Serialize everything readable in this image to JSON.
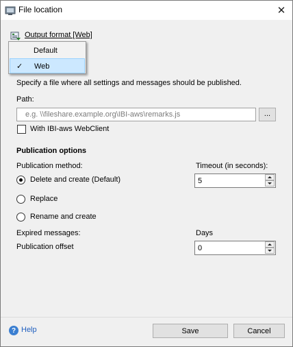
{
  "window": {
    "title": "File location",
    "close_glyph": "✕"
  },
  "output_format": {
    "link_text": "Output format [Web]",
    "icon": "output-format-icon",
    "menu": [
      {
        "label": "Default",
        "selected": false
      },
      {
        "label": "Web",
        "selected": true
      }
    ],
    "check_glyph": "✓"
  },
  "description": "Specify a file where all settings and messages should be published.",
  "path": {
    "label": "Path:",
    "placeholder": "e.g. \\\\fileshare.example.org\\IBI-aws\\remarks.js",
    "value": "",
    "browse_label": "..."
  },
  "webclient": {
    "label": "With IBI-aws WebClient",
    "checked": false
  },
  "publication": {
    "section_title": "Publication options",
    "method_label": "Publication method:",
    "timeout_label": "Timeout (in seconds):",
    "timeout_value": "5",
    "methods": [
      {
        "label": "Delete and create (Default)",
        "checked": true
      },
      {
        "label": "Replace",
        "checked": false
      },
      {
        "label": "Rename and create",
        "checked": false
      }
    ],
    "expired_label": "Expired messages:",
    "days_label": "Days",
    "offset_label": "Publication offset",
    "offset_value": "0"
  },
  "footer": {
    "help_label": "Help",
    "help_icon_glyph": "?",
    "save_label": "Save",
    "cancel_label": "Cancel"
  },
  "colors": {
    "accent": "#1f5fbf",
    "menu_selected_bg": "#cce8ff"
  }
}
